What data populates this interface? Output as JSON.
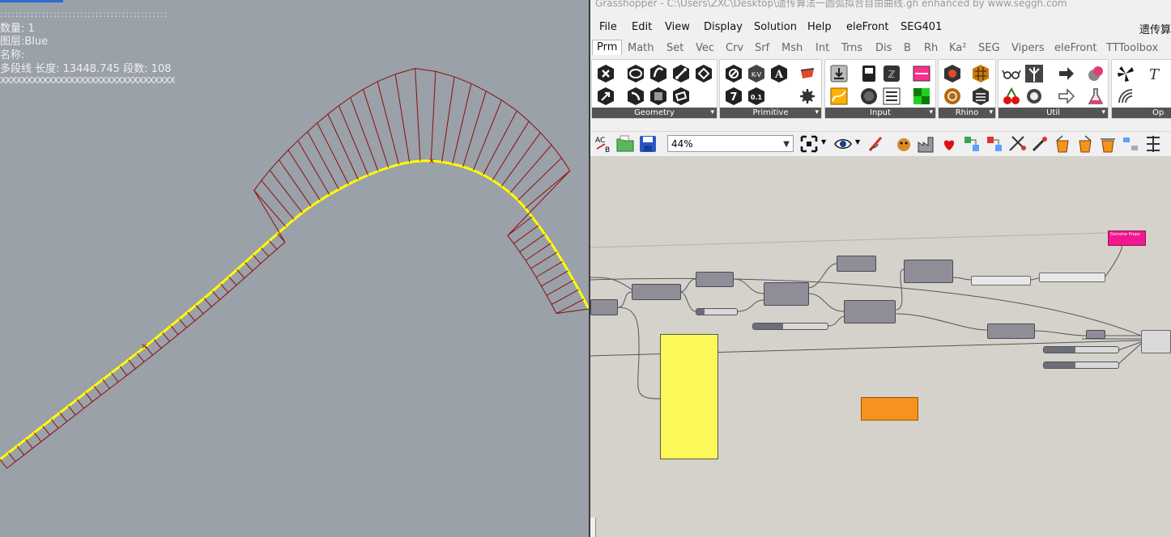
{
  "viewport": {
    "dots_line": "::::::::::::::::::::::::::::::::::::::::::::",
    "info": {
      "count": "数量: 1",
      "layer": "图层:Blue",
      "name": "名称:",
      "polyline": "多段线 长度: 13448.745 段数: 108"
    },
    "x_row": "XXXXXXXXXXXXXXXXXXXXXXXXXXXXXXXXX",
    "colors": {
      "background": "#9aa1a8",
      "curve": "#ffff00",
      "frames": "#8b0d12"
    }
  },
  "grasshopper": {
    "title": "Grasshopper - C:\\Users\\ZXC\\Desktop\\遗传算法一圆弧拟合自由曲线.gh  enhanced by www.seggh.com",
    "menus": [
      "File",
      "Edit",
      "View",
      "Display",
      "Solution",
      "Help",
      "eleFront",
      "SEG401"
    ],
    "menu_right": "遗传算",
    "tabs": [
      "Prm",
      "Math",
      "Set",
      "Vec",
      "Crv",
      "Srf",
      "Msh",
      "Int",
      "Trns",
      "Dis",
      "B",
      "Rh",
      "Ka²",
      "SEG",
      "Vipers",
      "eleFront",
      "TTToolbox"
    ],
    "active_tab": "Prm",
    "panels": {
      "geometry": "Geometry",
      "primitive": "Primitive",
      "input": "Input",
      "rhino": "Rhino",
      "util": "Util",
      "op": "Op"
    },
    "zoom": "44%",
    "pink_component_label": "Genome Prope",
    "colors": {
      "canvas": "#d5d2cc",
      "component": "#8e8d98",
      "yellow_panel": "#fdf85a",
      "orange_group": "#f6921e",
      "pink": "#f0188c"
    }
  }
}
